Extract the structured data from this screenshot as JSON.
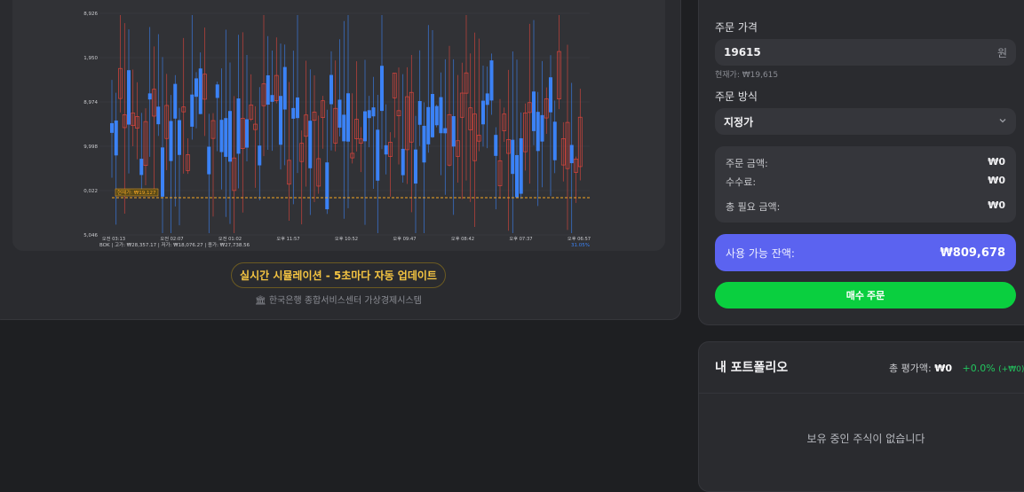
{
  "chart": {
    "y_ticks": [
      "8,926",
      "1,950",
      "8,974",
      "9,998",
      "0,022",
      "5,046"
    ],
    "x_ticks": [
      "오전 03:13",
      "오전 02:07",
      "오전 01:02",
      "오후 11:57",
      "오후 10:52",
      "오후 09:47",
      "오후 08:42",
      "오후 07:37",
      "오후 06:57"
    ],
    "current_price_tag": "현재가: ₩19,127",
    "footer_stats": "BOK | 고가: ₩28,357.17 | 저가: ₩18,076.27 | 종가: ₩27,738.56",
    "footer_pct": "31.05%",
    "colors": {
      "up": "#e0453c",
      "down": "#3b82f6",
      "current_line": "#f5a623"
    }
  },
  "sim_label": "실시간 시뮬레이션 - 5초마다 자동 업데이트",
  "bank_note": "한국은행 종합서비스센터 가상경제시스템",
  "bank_icon": "bank-icon",
  "order": {
    "price_label": "주문 가격",
    "price_value": "19615",
    "price_unit": "원",
    "current_price": "현재가: ₩19,615",
    "method_label": "주문 방식",
    "method_value": "지정가",
    "summary": [
      {
        "label": "주문 금액:",
        "value": "₩0"
      },
      {
        "label": "수수료:",
        "value": "₩0"
      },
      {
        "label": "총 필요 금액:",
        "value": "₩0"
      }
    ],
    "balance_label": "사용 가능 잔액:",
    "balance_value": "₩809,678",
    "buy_label": "매수 주문"
  },
  "portfolio": {
    "title": "내 포트폴리오",
    "total_label": "총 평가액:",
    "total_value": "₩0",
    "change_pct": "+0.0%",
    "change_abs": "(+₩0)",
    "empty_text": "보유 중인 주식이 없습니다"
  }
}
